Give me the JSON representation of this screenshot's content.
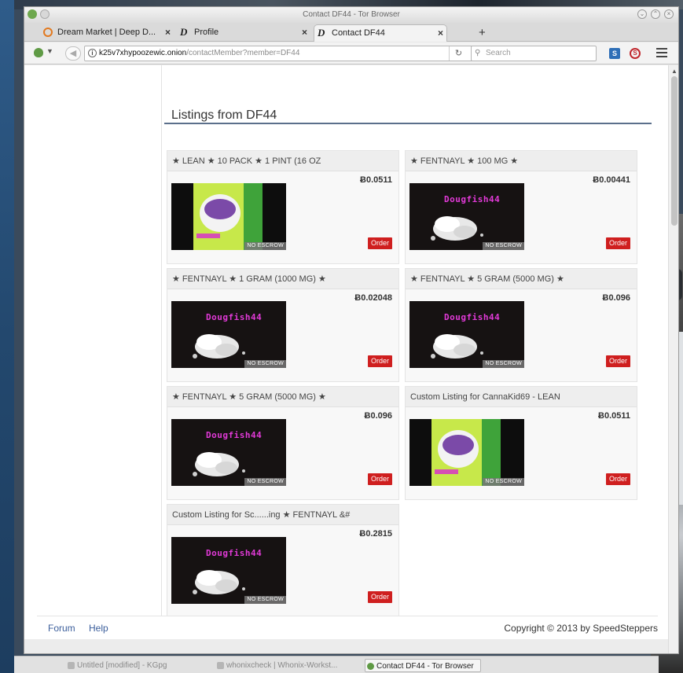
{
  "window": {
    "title": "Contact DF44 - Tor Browser"
  },
  "tabs": [
    {
      "label": "Dream Market | Deep D...",
      "icon": "dream-market-icon",
      "close": "×"
    },
    {
      "label": "Profile",
      "icon": "d-logo-icon",
      "close": "×"
    },
    {
      "label": "Contact DF44",
      "icon": "d-logo-icon",
      "close": "×"
    }
  ],
  "new_tab": "+",
  "navbar": {
    "url_host": "k25v7xhypoozewic.onion",
    "url_path": "/contactMember?member=DF44",
    "search_placeholder": "Search"
  },
  "page": {
    "title": "Listings from DF44",
    "currency_symbol": "Ƀ",
    "no_escrow_label": "NO ESCROW",
    "order_label": "Order",
    "brand_watermark": "Dougfish44"
  },
  "listings": [
    {
      "title": "★ LEAN ★ 10 PACK ★ 1 PINT (16 OZ",
      "price": "Ƀ0.0511",
      "image": "lean-cup"
    },
    {
      "title": "★ FENTNAYL ★ 100 MG ★",
      "price": "Ƀ0.00441",
      "image": "powder"
    },
    {
      "title": "★ FENTNAYL ★ 1 GRAM (1000 MG) ★",
      "price": "Ƀ0.02048",
      "image": "powder"
    },
    {
      "title": "★ FENTNAYL ★ 5 GRAM (5000 MG) ★",
      "price": "Ƀ0.096",
      "image": "powder"
    },
    {
      "title": "★ FENTNAYL ★ 5 GRAM (5000 MG) ★",
      "price": "Ƀ0.096",
      "image": "powder"
    },
    {
      "title": "Custom Listing for CannaKid69 - LEAN",
      "price": "Ƀ0.0511",
      "image": "lean-cup"
    },
    {
      "title": "Custom Listing for Sc......ing ★ FENTNAYL &#",
      "price": "Ƀ0.2815",
      "image": "powder"
    }
  ],
  "footer": {
    "links": [
      "Forum",
      "Help"
    ],
    "copyright": "Copyright © 2013 by SpeedSteppers"
  },
  "taskbar": [
    {
      "label": "Untitled [modified] - KGpg",
      "active": false
    },
    {
      "label": "whonixcheck | Whonix-Workst...",
      "active": false
    },
    {
      "label": "Contact DF44 - Tor Browser",
      "active": true
    }
  ]
}
